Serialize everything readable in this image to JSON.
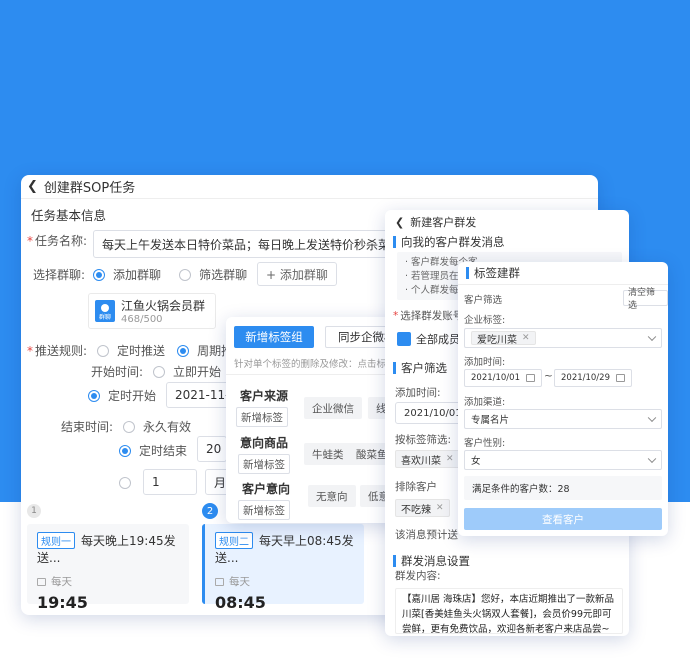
{
  "sop": {
    "title": "创建群SOP任务",
    "section": "任务基本信息",
    "task_name_label": "任务名称:",
    "task_name_value": "每天上午发送本日特价菜品；每日晚上发送特价秒杀菜品",
    "select_group_label": "选择群聊:",
    "opt_add_group": "添加群聊",
    "opt_filter_group": "筛选群聊",
    "add_group_btn": "+ 添加群聊",
    "group_name": "江鱼火锅会员群",
    "group_count": "468/500",
    "group_avatar_text": "群聊",
    "push_rule_label": "推送规则:",
    "opt_timed": "定时推送",
    "opt_cycle": "周期推",
    "start_time_label": "开始时间:",
    "opt_start_now": "立即开始",
    "opt_start_timed": "定时开始",
    "start_date": "2021-11-0",
    "end_time_label": "结束时间:",
    "opt_forever": "永久有效",
    "opt_end_timed": "定时结束",
    "end_date": "20",
    "repeat_count": "1",
    "repeat_unit": "月"
  },
  "rules": [
    {
      "step": "1",
      "tag": "规则一",
      "text": "每天晚上19:45发送...",
      "freq": "每天",
      "time": "19:45"
    },
    {
      "step": "2",
      "tag": "规则二",
      "text": "每天早上08:45发送...",
      "freq": "每天",
      "time": "08:45"
    }
  ],
  "tag_panel": {
    "tab_new": "新增标签组",
    "tab_sync": "同步企微标",
    "hint": "针对单个标签的删除及修改：点击标签",
    "add_tag": "新增标签",
    "groups": [
      {
        "title": "客户来源",
        "tags": [
          "企业微信",
          "线"
        ]
      },
      {
        "title": "意向商品",
        "tags": [
          "牛蛙类",
          "酸菜鱼"
        ]
      },
      {
        "title": "客户意向",
        "tags": [
          "无意向",
          "低意"
        ]
      }
    ]
  },
  "mass": {
    "title": "新建客户群发",
    "section_msg": "向我的客户群发消息",
    "tips": [
      "· 客户群发每个客",
      "· 若管理员在微",
      "· 个人群发每天"
    ],
    "account_label": "选择群发账号：",
    "all_members": "全部成员",
    "section_filter": "客户筛选",
    "add_time_label": "添加时间:",
    "add_time_value": "2021/10/01",
    "tag_filter_label": "按标签筛选:",
    "tag_filter_chip": "喜欢川菜",
    "exclude_label": "排除客户",
    "exclude_chip": "不吃辣",
    "estimate": "该消息预计送",
    "section_settings": "群发消息设置",
    "content_label": "群发内容:",
    "content": "【嘉川居 海珠店】您好，本店近期推出了一款新品川菜[香美娃鱼头火锅双人套餐]，会员价99元即可尝鲜，更有免费饮品，欢迎各新老客户来店品尝~更多菜品登录小程序查看！"
  },
  "label_build": {
    "title": "标签建群",
    "filter_label": "客户筛选",
    "clear_btn": "清空筛选",
    "corp_tag_label": "企业标签:",
    "corp_tag_chip": "爱吃川菜",
    "add_time_label": "添加时间:",
    "date_from": "2021/10/01",
    "date_sep": "~",
    "date_to": "2021/10/29",
    "channel_label": "添加渠道:",
    "channel_value": "专属名片",
    "gender_label": "客户性别:",
    "gender_value": "女",
    "count_text": "满足条件的客户数：28",
    "view_btn": "查看客户"
  },
  "colors": {
    "brand": "#2d8cf0",
    "background_top": "#2d8cf0"
  }
}
